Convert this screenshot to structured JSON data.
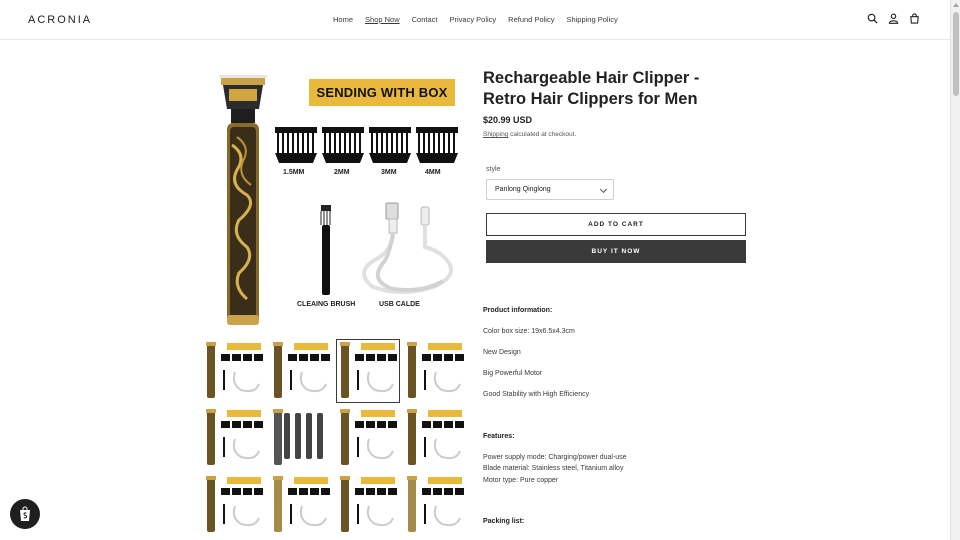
{
  "header": {
    "logo": "ACRONIA",
    "nav": [
      "Home",
      "Shop Now",
      "Contact",
      "Privacy Policy",
      "Refund Policy",
      "Shipping Policy"
    ],
    "active_nav": "Shop Now",
    "icons": [
      "search-icon",
      "account-icon",
      "cart-icon"
    ]
  },
  "product": {
    "title": "Rechargeable Hair Clipper - Retro Hair Clippers for Men",
    "price": "$20.99 USD",
    "shipping_link": "Shipping",
    "shipping_text": " calculated at checkout.",
    "option_label": "style",
    "option_value": "Panlong Qinglong",
    "add_to_cart": "ADD TO CART",
    "buy_now": "BUY IT NOW"
  },
  "main_image": {
    "badge": "SENDING WITH BOX",
    "comb_labels": [
      "1.5MM",
      "2MM",
      "3MM",
      "4MM"
    ],
    "brush_caption": "CLEAING BRUSH",
    "usb_caption": "USB CALDE"
  },
  "thumbnails": {
    "count": 12,
    "selected_index": 2
  },
  "description": {
    "product_info_heading": "Product information:",
    "product_info": [
      "Color box size: 19x6.5x4.3cm",
      "New Design",
      "Big Powerful Motor",
      "Good Stability with High Efficiency"
    ],
    "features_heading": "Features:",
    "features": [
      "Power supply mode: Charging/power dual-use",
      "Blade material: Stainless steel, Titanium alloy",
      "Motor type: Pure copper"
    ],
    "packing_heading": "Packing list:"
  },
  "colors": {
    "accent_gold": "#e8b93a",
    "button_dark": "#3a3a3a"
  }
}
